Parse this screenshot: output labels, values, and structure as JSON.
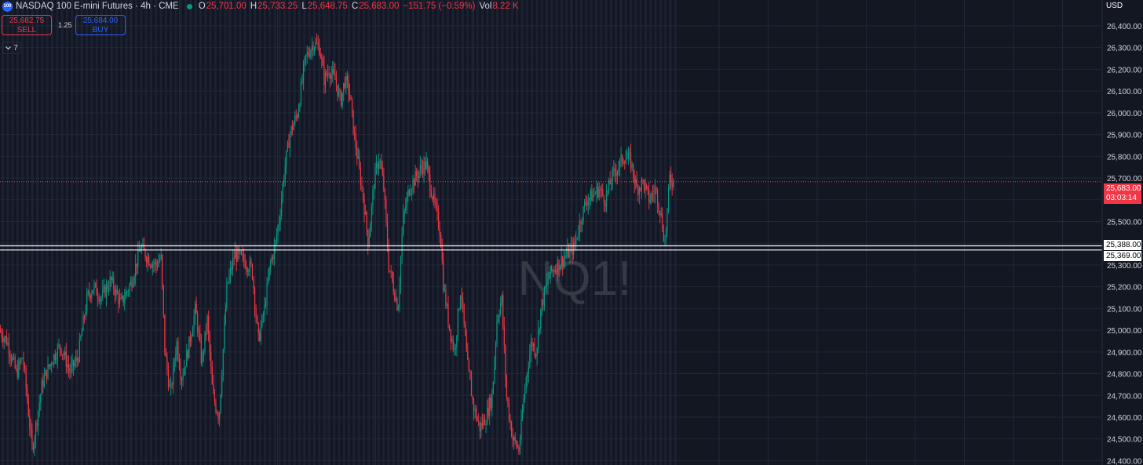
{
  "header": {
    "logo_text": "100",
    "title": "NASDAQ 100 E-mini Futures · 4h · CME",
    "open_label": "O",
    "open": "25,701.00",
    "high_label": "H",
    "high": "25,733.25",
    "low_label": "L",
    "low": "25,648.75",
    "close_label": "C",
    "close": "25,683.00",
    "change": "−151.75 (−0.59%)",
    "vol_label": "Vol",
    "volume": "8.22 K"
  },
  "trade": {
    "sell_price": "25,682.75",
    "sell_label": "SELL",
    "spread": "1.25",
    "buy_price": "25,684.00",
    "buy_label": "BUY"
  },
  "indicators_toggle": {
    "icon": "chevron-down-icon",
    "count": "7"
  },
  "axis": {
    "currency": "USD"
  },
  "watermark": "NQ1!",
  "last_price": {
    "price": "25,683.00",
    "countdown": "03:03:14"
  },
  "horizontal_lines": [
    {
      "value": 25388,
      "label": "25,388.00"
    },
    {
      "value": 25369,
      "label": "25,369.00"
    }
  ],
  "colors": {
    "up": "#089981",
    "down": "#f23645",
    "background": "#131722",
    "grid": "#232735",
    "session_band": "#1b2133",
    "hline": "#ffffff",
    "buy": "#2962ff"
  },
  "chart_data": {
    "type": "candlestick",
    "ylim": [
      24380,
      26490
    ],
    "y_ticks": [
      24400,
      24500,
      24600,
      24700,
      24800,
      24900,
      25000,
      25100,
      25200,
      25300,
      25400,
      25500,
      25600,
      25700,
      25800,
      25900,
      26000,
      26100,
      26200,
      26300,
      26400
    ],
    "y_tick_labels": [
      "24,400.00",
      "24,500.00",
      "24,600.00",
      "24,700.00",
      "24,800.00",
      "24,900.00",
      "25,000.00",
      "25,100.00",
      "25,200.00",
      "25,300.00",
      "25,400.00",
      "25,500.00",
      "25,600.00",
      "25,700.00",
      "25,800.00",
      "25,900.00",
      "26,000.00",
      "26,100.00",
      "26,200.00",
      "26,300.00",
      "26,400.00"
    ],
    "trend": [
      [
        0,
        25000
      ],
      [
        10,
        24950
      ],
      [
        22,
        24800
      ],
      [
        30,
        24880
      ],
      [
        42,
        24450
      ],
      [
        55,
        24760
      ],
      [
        68,
        24870
      ],
      [
        78,
        24930
      ],
      [
        90,
        24810
      ],
      [
        100,
        24870
      ],
      [
        112,
        25150
      ],
      [
        120,
        25200
      ],
      [
        130,
        25150
      ],
      [
        142,
        25230
      ],
      [
        155,
        25120
      ],
      [
        168,
        25220
      ],
      [
        180,
        25380
      ],
      [
        192,
        25320
      ],
      [
        200,
        25300
      ],
      [
        206,
        25340
      ],
      [
        211,
        24900
      ],
      [
        218,
        24700
      ],
      [
        226,
        24950
      ],
      [
        232,
        24780
      ],
      [
        240,
        24900
      ],
      [
        250,
        25100
      ],
      [
        258,
        24850
      ],
      [
        265,
        25050
      ],
      [
        272,
        24700
      ],
      [
        280,
        24600
      ],
      [
        290,
        25200
      ],
      [
        300,
        25350
      ],
      [
        312,
        25320
      ],
      [
        322,
        25280
      ],
      [
        330,
        24950
      ],
      [
        338,
        25100
      ],
      [
        345,
        25300
      ],
      [
        352,
        25400
      ],
      [
        358,
        25550
      ],
      [
        362,
        25700
      ],
      [
        370,
        25900
      ],
      [
        380,
        26000
      ],
      [
        390,
        26250
      ],
      [
        400,
        26320
      ],
      [
        408,
        26300
      ],
      [
        414,
        26150
      ],
      [
        420,
        26200
      ],
      [
        428,
        26150
      ],
      [
        435,
        26050
      ],
      [
        440,
        26150
      ],
      [
        446,
        26100
      ],
      [
        452,
        25900
      ],
      [
        458,
        25750
      ],
      [
        464,
        25600
      ],
      [
        470,
        25400
      ],
      [
        478,
        25700
      ],
      [
        484,
        25800
      ],
      [
        490,
        25650
      ],
      [
        496,
        25300
      ],
      [
        502,
        25200
      ],
      [
        508,
        25100
      ],
      [
        514,
        25500
      ],
      [
        522,
        25650
      ],
      [
        530,
        25700
      ],
      [
        538,
        25750
      ],
      [
        544,
        25760
      ],
      [
        550,
        25650
      ],
      [
        556,
        25550
      ],
      [
        562,
        25450
      ],
      [
        566,
        25200
      ],
      [
        574,
        25000
      ],
      [
        580,
        24900
      ],
      [
        588,
        25200
      ],
      [
        596,
        24850
      ],
      [
        604,
        24650
      ],
      [
        612,
        24550
      ],
      [
        620,
        24600
      ],
      [
        628,
        24700
      ],
      [
        634,
        25050
      ],
      [
        640,
        25150
      ],
      [
        646,
        24700
      ],
      [
        654,
        24500
      ],
      [
        662,
        24450
      ],
      [
        670,
        24750
      ],
      [
        678,
        24950
      ],
      [
        684,
        24900
      ],
      [
        690,
        25100
      ],
      [
        700,
        25250
      ],
      [
        710,
        25300
      ],
      [
        716,
        25320
      ],
      [
        724,
        25350
      ],
      [
        732,
        25380
      ],
      [
        740,
        25500
      ],
      [
        748,
        25600
      ],
      [
        756,
        25620
      ],
      [
        764,
        25650
      ],
      [
        772,
        25600
      ],
      [
        780,
        25700
      ],
      [
        788,
        25750
      ],
      [
        796,
        25800
      ],
      [
        804,
        25780
      ],
      [
        812,
        25650
      ],
      [
        820,
        25680
      ],
      [
        828,
        25600
      ],
      [
        836,
        25650
      ],
      [
        842,
        25550
      ],
      [
        848,
        25400
      ],
      [
        854,
        25700
      ],
      [
        858,
        25683
      ]
    ]
  }
}
